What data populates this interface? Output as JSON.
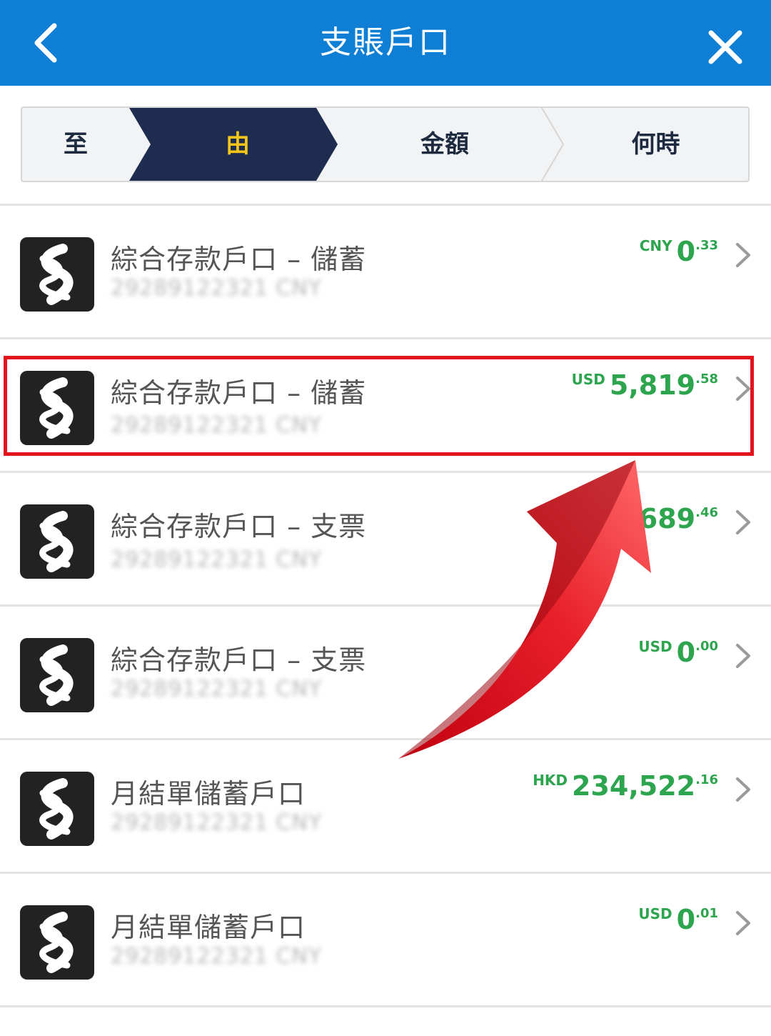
{
  "header": {
    "title": "支賬戶口",
    "back_icon": "chevron-left-icon",
    "close_icon": "close-icon",
    "bg_color": "#0f7fd6"
  },
  "stepper": {
    "steps": [
      {
        "label": "至",
        "state": "done"
      },
      {
        "label": "由",
        "state": "active"
      },
      {
        "label": "金額",
        "state": "pending"
      },
      {
        "label": "何時",
        "state": "pending"
      }
    ],
    "active_bg": "#1e2d4f",
    "active_text_color": "#f5c518"
  },
  "accounts": [
    {
      "name": "綜合存款戶口 – 儲蓄",
      "number": "29289122321 CNY",
      "currency": "CNY",
      "amount_int": "0",
      "amount_dec": ".33"
    },
    {
      "name": "綜合存款戶口 – 儲蓄",
      "number": "29289122321 CNY",
      "currency": "USD",
      "amount_int": "5,819",
      "amount_dec": ".58"
    },
    {
      "name": "綜合存款戶口 – 支票",
      "number": "29289122321 CNY",
      "currency": "",
      "amount_int": ",689",
      "amount_dec": ".46"
    },
    {
      "name": "綜合存款戶口 – 支票",
      "number": "29289122321 CNY",
      "currency": "USD",
      "amount_int": "0",
      "amount_dec": ".00"
    },
    {
      "name": "月結單儲蓄戶口",
      "number": "29289122321 CNY",
      "currency": "HKD",
      "amount_int": "234,522",
      "amount_dec": ".16"
    },
    {
      "name": "月結單儲蓄戶口",
      "number": "29289122321 CNY",
      "currency": "USD",
      "amount_int": "0",
      "amount_dec": ".01"
    }
  ],
  "icons": {
    "logo": "bank-logo-icon",
    "chevron": "chevron-right-icon",
    "annotation": "red-arrow-icon"
  },
  "colors": {
    "amount": "#2da44e",
    "highlight": "#e3141b"
  }
}
